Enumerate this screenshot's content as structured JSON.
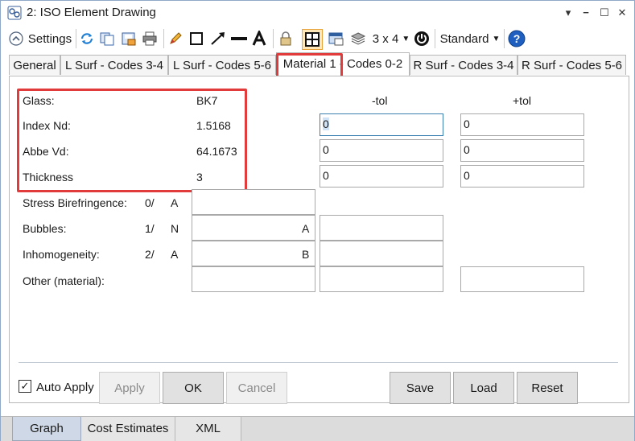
{
  "window": {
    "title": "2: ISO Element Drawing"
  },
  "toolbar": {
    "settings_label": "Settings",
    "grid_label": "3 x 4",
    "style_label": "Standard",
    "icons": [
      "collapse-icon",
      "refresh-icon",
      "copy-icon",
      "save-image-icon",
      "print-icon",
      "pencil-icon",
      "rectangle-icon",
      "arrow-line-icon",
      "line-icon",
      "text-icon",
      "lock-icon",
      "layout-icon",
      "window-icon",
      "layers-icon",
      "power-icon",
      "help-icon"
    ]
  },
  "tabs": [
    {
      "label": "General"
    },
    {
      "label": "L Surf - Codes 3-4"
    },
    {
      "label": "L Surf - Codes 5-6"
    },
    {
      "label": "Material 1 - Codes 0-2"
    },
    {
      "label": "R Surf - Codes 3-4"
    },
    {
      "label": "R Surf - Codes 5-6"
    }
  ],
  "columns": {
    "minus_tol": "-tol",
    "plus_tol": "+tol"
  },
  "material": {
    "glass_label": "Glass:",
    "glass_value": "BK7",
    "index_label": "Index Nd:",
    "index_value": "1.5168",
    "abbe_label": "Abbe Vd:",
    "abbe_value": "64.1673",
    "thickness_label": "Thickness",
    "thickness_value": "3",
    "index_minus_tol": "0",
    "index_plus_tol": "0",
    "abbe_minus_tol": "0",
    "abbe_plus_tol": "0",
    "thickness_minus_tol": "0",
    "thickness_plus_tol": "0"
  },
  "codes": {
    "stress_label": "Stress Birefringence:",
    "stress_code": "0/",
    "stress_class": "A",
    "bubbles_label": "Bubbles:",
    "bubbles_code": "1/",
    "bubbles_class": "N",
    "bubbles_class2": "A",
    "inhom_label": "Inhomogeneity:",
    "inhom_code": "2/",
    "inhom_class": "A",
    "inhom_class2": "B",
    "other_label": "Other (material):"
  },
  "actions": {
    "auto_apply_label": "Auto Apply",
    "auto_apply_checked": "✓",
    "apply": "Apply",
    "ok": "OK",
    "cancel": "Cancel",
    "save": "Save",
    "load": "Load",
    "reset": "Reset"
  },
  "bottom_tabs": [
    {
      "label": "Graph"
    },
    {
      "label": "Cost Estimates"
    },
    {
      "label": "XML"
    }
  ],
  "colors": {
    "highlight_red": "#e23b3b",
    "focus_blue": "#3c7fb1",
    "help_blue": "#1f5fbf"
  }
}
